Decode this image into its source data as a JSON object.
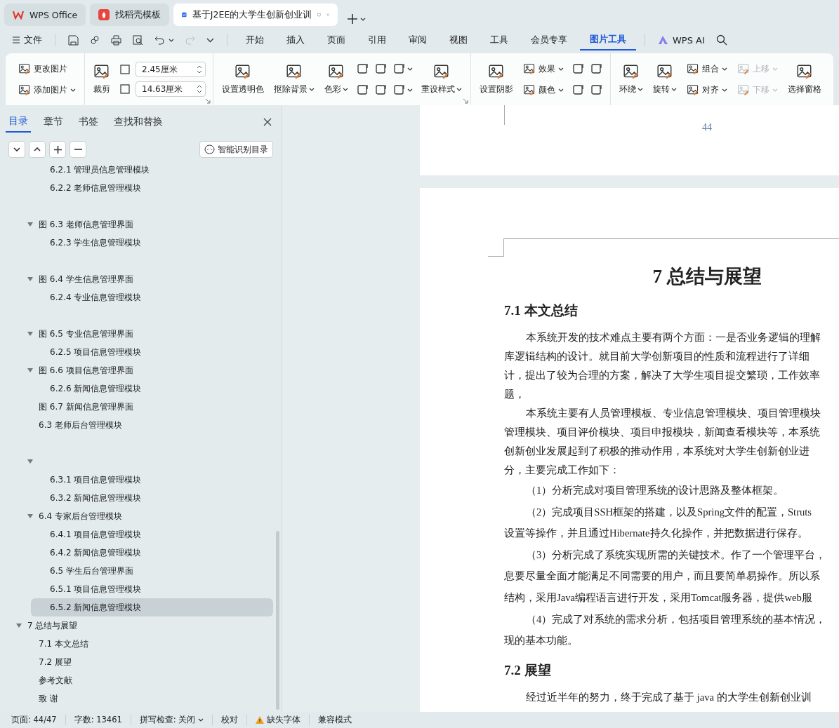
{
  "tabs": [
    {
      "kind": "home",
      "label": "WPS Office",
      "selected": false
    },
    {
      "kind": "template",
      "label": "找稻壳模板",
      "selected": false
    },
    {
      "kind": "document",
      "label": "基于J2EE的大学生创新创业训",
      "selected": true
    }
  ],
  "menu": {
    "file": "文件",
    "items": [
      {
        "label": "开始",
        "selected": false
      },
      {
        "label": "插入",
        "selected": false
      },
      {
        "label": "页面",
        "selected": false
      },
      {
        "label": "引用",
        "selected": false
      },
      {
        "label": "审阅",
        "selected": false
      },
      {
        "label": "视图",
        "selected": false
      },
      {
        "label": "工具",
        "selected": false
      },
      {
        "label": "会员专享",
        "selected": false
      },
      {
        "label": "图片工具",
        "selected": true
      }
    ],
    "ai": "WPS AI"
  },
  "ribbon": {
    "groups": [
      {
        "launcher": false,
        "items": [
          {
            "kind": "stack",
            "entries": [
              {
                "label": "更改图片",
                "dropdown": false,
                "disabled": false
              },
              {
                "label": "添加图片",
                "dropdown": true,
                "disabled": false
              }
            ]
          }
        ]
      },
      {
        "launcher": true,
        "items": [
          {
            "kind": "large",
            "label": "裁剪",
            "dropdown": false
          },
          {
            "kind": "fields",
            "entries": [
              {
                "value": "2.45厘米"
              },
              {
                "value": "14.63厘米"
              }
            ]
          }
        ]
      },
      {
        "launcher": true,
        "items": [
          {
            "kind": "large",
            "label": "设置透明色",
            "dropdown": false
          },
          {
            "kind": "large",
            "label": "抠除背景",
            "dropdown": true
          },
          {
            "kind": "large",
            "label": "色彩",
            "dropdown": true
          },
          {
            "kind": "icons",
            "entries": [
              {
                "dropdown": false
              },
              {
                "dropdown": false
              },
              {
                "dropdown": false
              },
              {
                "dropdown": false
              },
              {
                "dropdown": true
              },
              {
                "dropdown": true
              }
            ]
          },
          {
            "kind": "large",
            "label": "重设样式",
            "dropdown": true
          }
        ]
      },
      {
        "launcher": false,
        "items": [
          {
            "kind": "large",
            "label": "设置阴影",
            "dropdown": false
          },
          {
            "kind": "stack",
            "entries": [
              {
                "label": "效果",
                "dropdown": true,
                "disabled": false
              },
              {
                "label": "颜色",
                "dropdown": true,
                "disabled": false
              }
            ]
          },
          {
            "kind": "icons",
            "entries": [
              {
                "dropdown": false
              },
              {
                "dropdown": false
              },
              {
                "dropdown": false
              },
              {
                "dropdown": false
              }
            ]
          }
        ]
      },
      {
        "launcher": false,
        "items": [
          {
            "kind": "large",
            "label": "环绕",
            "dropdown": true
          },
          {
            "kind": "large",
            "label": "旋转",
            "dropdown": true
          },
          {
            "kind": "stack",
            "entries": [
              {
                "label": "组合",
                "dropdown": true,
                "disabled": false
              },
              {
                "label": "对齐",
                "dropdown": true,
                "disabled": false
              }
            ]
          },
          {
            "kind": "stack",
            "entries": [
              {
                "label": "上移",
                "dropdown": true,
                "disabled": true
              },
              {
                "label": "下移",
                "dropdown": true,
                "disabled": true
              }
            ]
          },
          {
            "kind": "large",
            "label": "选择窗格",
            "dropdown": false
          }
        ]
      }
    ]
  },
  "sidebar": {
    "tabs": [
      {
        "label": "目录",
        "selected": true
      },
      {
        "label": "章节",
        "selected": false
      },
      {
        "label": "书签",
        "selected": false
      },
      {
        "label": "查找和替换",
        "selected": false
      }
    ],
    "smart_button": "智能识别目录",
    "toc": [
      {
        "kind": "group",
        "children": [
          {
            "kind": "group",
            "children": [
              {
                "kind": "entry",
                "title": "6.2.1  管理员信息管理模块",
                "selected": false
              },
              {
                "kind": "entry",
                "title": "6.2.2  老师信息管理模块",
                "selected": false
              }
            ]
          },
          {
            "kind": "blank"
          },
          {
            "kind": "entry",
            "title": "图 6.3  老师信息管理界面",
            "selected": false,
            "expanded": true,
            "children": [
              {
                "kind": "entry",
                "title": "6.2.3  学生信息管理模块",
                "selected": false
              }
            ]
          },
          {
            "kind": "blank"
          },
          {
            "kind": "entry",
            "title": "图 6.4  学生信息管理界面",
            "selected": false,
            "expanded": true,
            "children": [
              {
                "kind": "entry",
                "title": "6.2.4  专业信息管理模块",
                "selected": false
              }
            ]
          },
          {
            "kind": "blank"
          },
          {
            "kind": "entry",
            "title": "图 6.5  专业信息管理界面",
            "selected": false,
            "expanded": true,
            "children": [
              {
                "kind": "entry",
                "title": "6.2.5  项目信息管理模块",
                "selected": false
              }
            ]
          },
          {
            "kind": "entry",
            "title": "图 6.6  项目信息管理界面",
            "selected": false,
            "expanded": true,
            "children": [
              {
                "kind": "entry",
                "title": "6.2.6  新闻信息管理模块",
                "selected": false
              }
            ]
          },
          {
            "kind": "entry",
            "title": "图 6.7  新闻信息管理界面",
            "selected": false
          },
          {
            "kind": "entry",
            "title": "6.3  老师后台管理模块",
            "selected": false
          },
          {
            "kind": "blank"
          },
          {
            "kind": "entry",
            "selected": false,
            "expanded": true,
            "children": [
              {
                "kind": "entry",
                "title": "6.3.1  项目信息管理模块",
                "selected": false
              },
              {
                "kind": "entry",
                "title": "6.3.2  新闻信息管理模块",
                "selected": false
              }
            ]
          },
          {
            "kind": "entry",
            "title": "6.4  专家后台管理模块",
            "selected": false,
            "expanded": true,
            "children": [
              {
                "kind": "entry",
                "title": "6.4.1  项目信息管理模块",
                "selected": false
              },
              {
                "kind": "entry",
                "title": "6.4.2  新闻信息管理模块",
                "selected": false
              },
              {
                "kind": "entry",
                "title": "6.5  学生后台管理界面",
                "selected": false
              },
              {
                "kind": "entry",
                "title": "6.5.1  项目信息管理模块",
                "selected": false
              },
              {
                "kind": "entry",
                "title": "6.5.2  新闻信息管理模块",
                "selected": true
              }
            ]
          }
        ]
      },
      {
        "kind": "entry",
        "title": "7 总结与展望",
        "selected": false,
        "expanded": true,
        "children": [
          {
            "kind": "entry",
            "title": "7.1  本文总结",
            "selected": false
          },
          {
            "kind": "entry",
            "title": "7.2  展望",
            "selected": false
          },
          {
            "kind": "entry",
            "title": "参考文献",
            "selected": false
          },
          {
            "kind": "entry",
            "title": "致  谢",
            "selected": false
          }
        ]
      }
    ]
  },
  "document": {
    "page_number": "44",
    "blocks": [
      {
        "kind": "title",
        "text": "7 总结与展望"
      },
      {
        "kind": "heading",
        "text": "7.1  本文总结"
      },
      {
        "kind": "line",
        "indent": true,
        "text": "本系统开发的技术难点主要有两个方面：一是否业务逻辑的理解"
      },
      {
        "kind": "line",
        "indent": false,
        "text": "库逻辑结构的设计。就目前大学创新项目的性质和流程进行了详细"
      },
      {
        "kind": "line",
        "indent": false,
        "text": "计，提出了较为合理的方案，解决了大学生项目提交繁琐，工作效率"
      },
      {
        "kind": "line",
        "indent": false,
        "text": "题，"
      },
      {
        "kind": "line",
        "indent": true,
        "text": "本系统主要有人员管理模板、专业信息管理模块、项目管理模块"
      },
      {
        "kind": "line",
        "indent": false,
        "text": "管理模块、项目评价模块、项目申报模块，新闻查看模块等，本系统"
      },
      {
        "kind": "line",
        "indent": false,
        "text": "创新创业发展起到了积极的推动作用，本系统对大学生创新创业进"
      },
      {
        "kind": "line",
        "indent": false,
        "text": "分，主要完成工作如下："
      },
      {
        "kind": "item",
        "indent": true,
        "text": "（1）分析完成对项目管理系统的设计思路及整体框架。"
      },
      {
        "kind": "item",
        "indent": true,
        "text": "（2）完成项目SSH框架的搭建，以及Spring文件的配置，Struts"
      },
      {
        "kind": "item",
        "indent": false,
        "text": "设置等操作，并且通过Hibernate持久化操作，并把数据进行保存。"
      },
      {
        "kind": "item",
        "indent": true,
        "text": "（3）分析完成了系统实现所需的关键技术。作了一个管理平台，"
      },
      {
        "kind": "item",
        "indent": false,
        "text": "息要尽量全面才能满足不同需要的用户，而且要简单易操作。所以系"
      },
      {
        "kind": "item",
        "indent": false,
        "text": "结构，采用Java编程语言进行开发，采用Tomcat服务器，提供web服"
      },
      {
        "kind": "item",
        "indent": true,
        "text": "（4）完成了对系统的需求分析，包括项目管理系统的基本情况，"
      },
      {
        "kind": "item",
        "indent": false,
        "text": "现的基本功能。"
      },
      {
        "kind": "heading",
        "text": "7.2  展望"
      },
      {
        "kind": "line",
        "indent": true,
        "text": "经过近半年的努力，终于完成了基于 java 的大学生创新创业训"
      }
    ]
  },
  "status_bar": [
    {
      "text": "页面: 44/47",
      "dropdown": false,
      "warning": false
    },
    {
      "text": "字数: 13461",
      "dropdown": false,
      "warning": false
    },
    {
      "text": "拼写检查: 关闭",
      "dropdown": true,
      "warning": false
    },
    {
      "text": "校对",
      "dropdown": false,
      "warning": false
    },
    {
      "text": "缺失字体",
      "dropdown": false,
      "warning": true
    },
    {
      "text": "兼容模式",
      "dropdown": false,
      "warning": false
    }
  ]
}
